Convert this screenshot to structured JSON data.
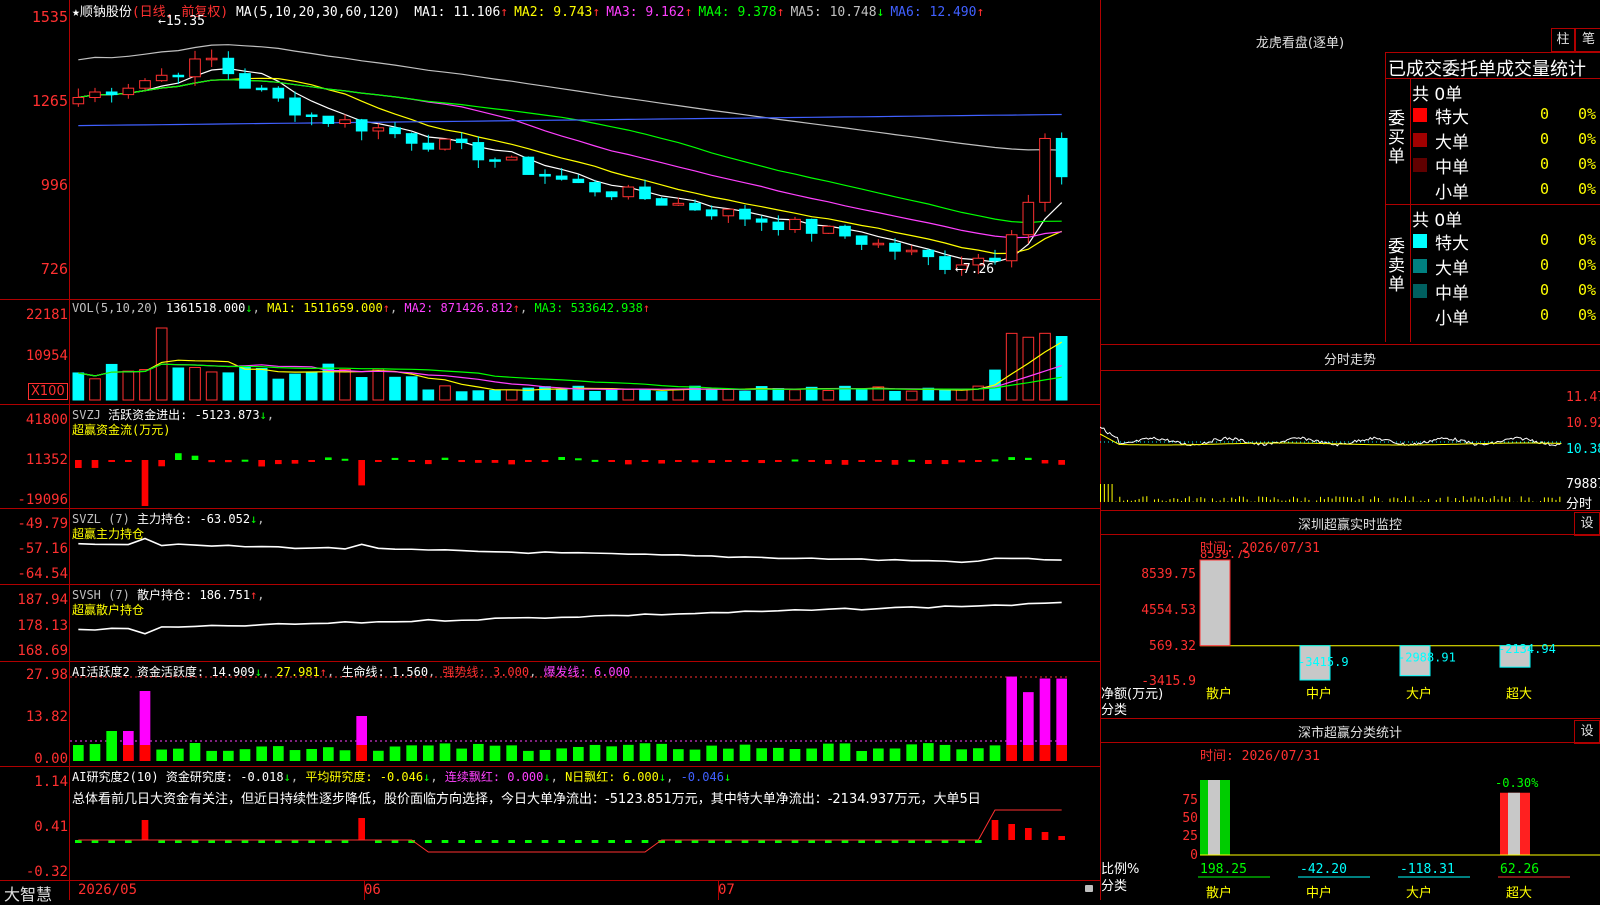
{
  "stock": {
    "name": "顺钠股份",
    "mode": "(日线, 前复权)",
    "star": "★"
  },
  "ma_header": {
    "label": "MA(5,10,20,30,60,120)",
    "items": [
      {
        "k": "MA1:",
        "v": "11.106",
        "arrow": "↑",
        "color": "#ffffff"
      },
      {
        "k": "MA2:",
        "v": "9.743",
        "arrow": "↑",
        "color": "#ffff00"
      },
      {
        "k": "MA3:",
        "v": "9.162",
        "arrow": "↑",
        "color": "#ff40ff"
      },
      {
        "k": "MA4:",
        "v": "9.378",
        "arrow": "↑",
        "color": "#00ff00"
      },
      {
        "k": "MA5:",
        "v": "10.748",
        "arrow": "↓",
        "color": "#c0c0c0"
      },
      {
        "k": "MA6:",
        "v": "12.490",
        "arrow": "↑",
        "color": "#4060ff"
      }
    ]
  },
  "price_axis": [
    "1535",
    "1265",
    "996",
    "726"
  ],
  "price_marks": {
    "high": "←15.35",
    "low": "←7.26"
  },
  "vol": {
    "header": "VOL(5,10,20)",
    "val": "1361518.000",
    "arrow": "↓",
    "ma1": "MA1: 1511659.000",
    "ma2": "MA2: 871426.812",
    "ma3": "MA3: 533642.938",
    "axis": [
      "22181",
      "10954"
    ],
    "unit": "X100"
  },
  "svzj": {
    "title": "SVZJ",
    "label": "活跃资金进出: -5123.873",
    "arrow": "↓",
    "sub": "超赢资金流(万元)",
    "axis": [
      "41800",
      "11352",
      "-19096"
    ]
  },
  "svzl": {
    "title": "SVZL (7)",
    "label": "主力持仓: -63.052",
    "arrow": "↓",
    "sub": "超赢主力持仓",
    "axis": [
      "-49.79",
      "-57.16",
      "-64.54"
    ]
  },
  "svsh": {
    "title": "SVSH (7)",
    "label": "散户持仓: 186.751",
    "arrow": "↑",
    "sub": "超赢散户持仓",
    "axis": [
      "187.94",
      "178.13",
      "168.69"
    ]
  },
  "ai1": {
    "title": "AI活跃度2",
    "label": "资金活跃度: 14.909",
    "arrow": "↓",
    "v2": "27.981",
    "life": "生命线: 1.560",
    "strong": "强势线: 3.000",
    "burst": "爆发线: 6.000",
    "axis": [
      "27.98",
      "13.82",
      "0.00"
    ]
  },
  "ai2": {
    "title": "AI研究度2(10)",
    "label": "资金研究度: -0.018",
    "avg": "平均研究度: -0.046",
    "cont": "连续飘红: 0.000",
    "nday": "N日飘红: 6.000",
    "last": "-0.046",
    "axis": [
      "1.14",
      "0.41",
      "-0.32"
    ],
    "text": "总体看前几日大资金有关注，但近日持续性逐步降低，股价面临方向选择，今日大单净流出：-5123.851万元，其中特大单净流出：-2134.937万元，大单5日"
  },
  "dates": [
    "2026/05",
    "06",
    "07"
  ],
  "footer_logo": "大智慧",
  "lhb": {
    "title": "龙虎看盘(逐单)",
    "btn1": "柱",
    "btn2": "笔",
    "header": "已成交委托单成交量统计",
    "buy": {
      "side": "委买单",
      "total": "共 0单",
      "rows": [
        {
          "name": "特大",
          "count": "0",
          "pct": "0%",
          "color": "#ff0000"
        },
        {
          "name": "大单",
          "count": "0",
          "pct": "0%",
          "color": "#a00000"
        },
        {
          "name": "中单",
          "count": "0",
          "pct": "0%",
          "color": "#600000"
        },
        {
          "name": "小单",
          "count": "0",
          "pct": "0%",
          "color": "#000000"
        }
      ]
    },
    "sell": {
      "side": "委卖单",
      "total": "共 0单",
      "rows": [
        {
          "name": "特大",
          "count": "0",
          "pct": "0%",
          "color": "#00ffff"
        },
        {
          "name": "大单",
          "count": "0",
          "pct": "0%",
          "color": "#008080"
        },
        {
          "name": "中单",
          "count": "0",
          "pct": "0%",
          "color": "#006060"
        },
        {
          "name": "小单",
          "count": "0",
          "pct": "0%",
          "color": "#000000"
        }
      ]
    }
  },
  "intraday": {
    "title": "分时走势",
    "axis": [
      "11.47",
      "10.92",
      "10.38",
      "79887",
      "分时"
    ]
  },
  "monitor": {
    "title": "深圳超赢实时监控",
    "btn": "设",
    "time": "时间: 2026/07/31",
    "axis": [
      "8539.75",
      "4554.53",
      "569.32",
      "-3415.9"
    ],
    "ylabel": "净额(万元)",
    "xlabel": "分类",
    "chart_data": {
      "type": "bar",
      "categories": [
        "散户",
        "中户",
        "大户",
        "超大"
      ],
      "values": [
        8539.75,
        -3415.9,
        -2988.91,
        -2134.94
      ],
      "labels": [
        "8539.75",
        "-3415.9",
        "-2988.91",
        "-2134.94"
      ]
    }
  },
  "classstat": {
    "title": "深市超赢分类统计",
    "btn": "设",
    "time": "时间: 2026/07/31",
    "axis": [
      "75",
      "50",
      "25",
      "0"
    ],
    "ylabel": "比例%",
    "xlabel": "分类",
    "chart_data": {
      "type": "bar",
      "categories": [
        "散户",
        "中户",
        "大户",
        "超大"
      ],
      "values": [
        198.25,
        -42.2,
        -118.31,
        62.26
      ],
      "top_label": "-0.30%",
      "labels": [
        "198.25",
        "-42.20",
        "-118.31",
        "62.26"
      ]
    }
  }
}
